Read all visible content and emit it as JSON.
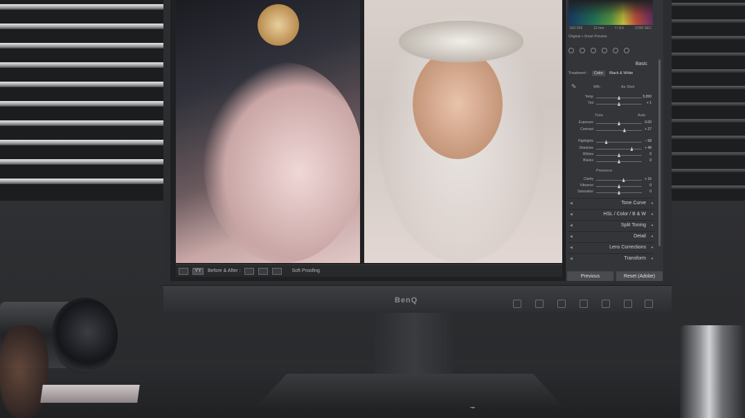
{
  "monitor": {
    "brand": "BenQ"
  },
  "view_toolbar": {
    "mode_label": "YY",
    "before_after_label": "Before & After :",
    "soft_proofing_label": "Soft Proofing"
  },
  "histogram": {
    "info": [
      "ISO 500",
      "12 mm",
      "f / 8.0",
      "1/200 SEC"
    ],
    "preview_label": "Original + Smart Preview"
  },
  "basic": {
    "title": "Basic",
    "treatment_label": "Treatment :",
    "color_option": "Color",
    "bw_option": "Black & White",
    "wb_label": "WB :",
    "wb_value": "As Shot",
    "tone_label": "Tone",
    "auto_label": "Auto",
    "presence_label": "Presence",
    "sliders": [
      {
        "label": "Temp",
        "value": "5,050"
      },
      {
        "label": "Tint",
        "value": "+ 1"
      },
      {
        "label": "Exposure",
        "value": "0.00"
      },
      {
        "label": "Contrast",
        "value": "+ 27"
      },
      {
        "label": "Highlights",
        "value": "− 58"
      },
      {
        "label": "Shadows",
        "value": "+ 48"
      },
      {
        "label": "Whites",
        "value": "0"
      },
      {
        "label": "Blacks",
        "value": "0"
      },
      {
        "label": "Clarity",
        "value": "+ 15"
      },
      {
        "label": "Vibrance",
        "value": "0"
      },
      {
        "label": "Saturation",
        "value": "0"
      }
    ]
  },
  "panels": [
    {
      "label": "Tone Curve"
    },
    {
      "label": "HSL / Color / B & W"
    },
    {
      "label": "Split Toning"
    },
    {
      "label": "Detail"
    },
    {
      "label": "Lens Corrections"
    },
    {
      "label": "Transform"
    }
  ],
  "buttons": {
    "previous": "Previous",
    "reset": "Reset (Adobe)"
  },
  "colors": {
    "panel_bg": "#343538",
    "accent": "#c9cacd"
  }
}
